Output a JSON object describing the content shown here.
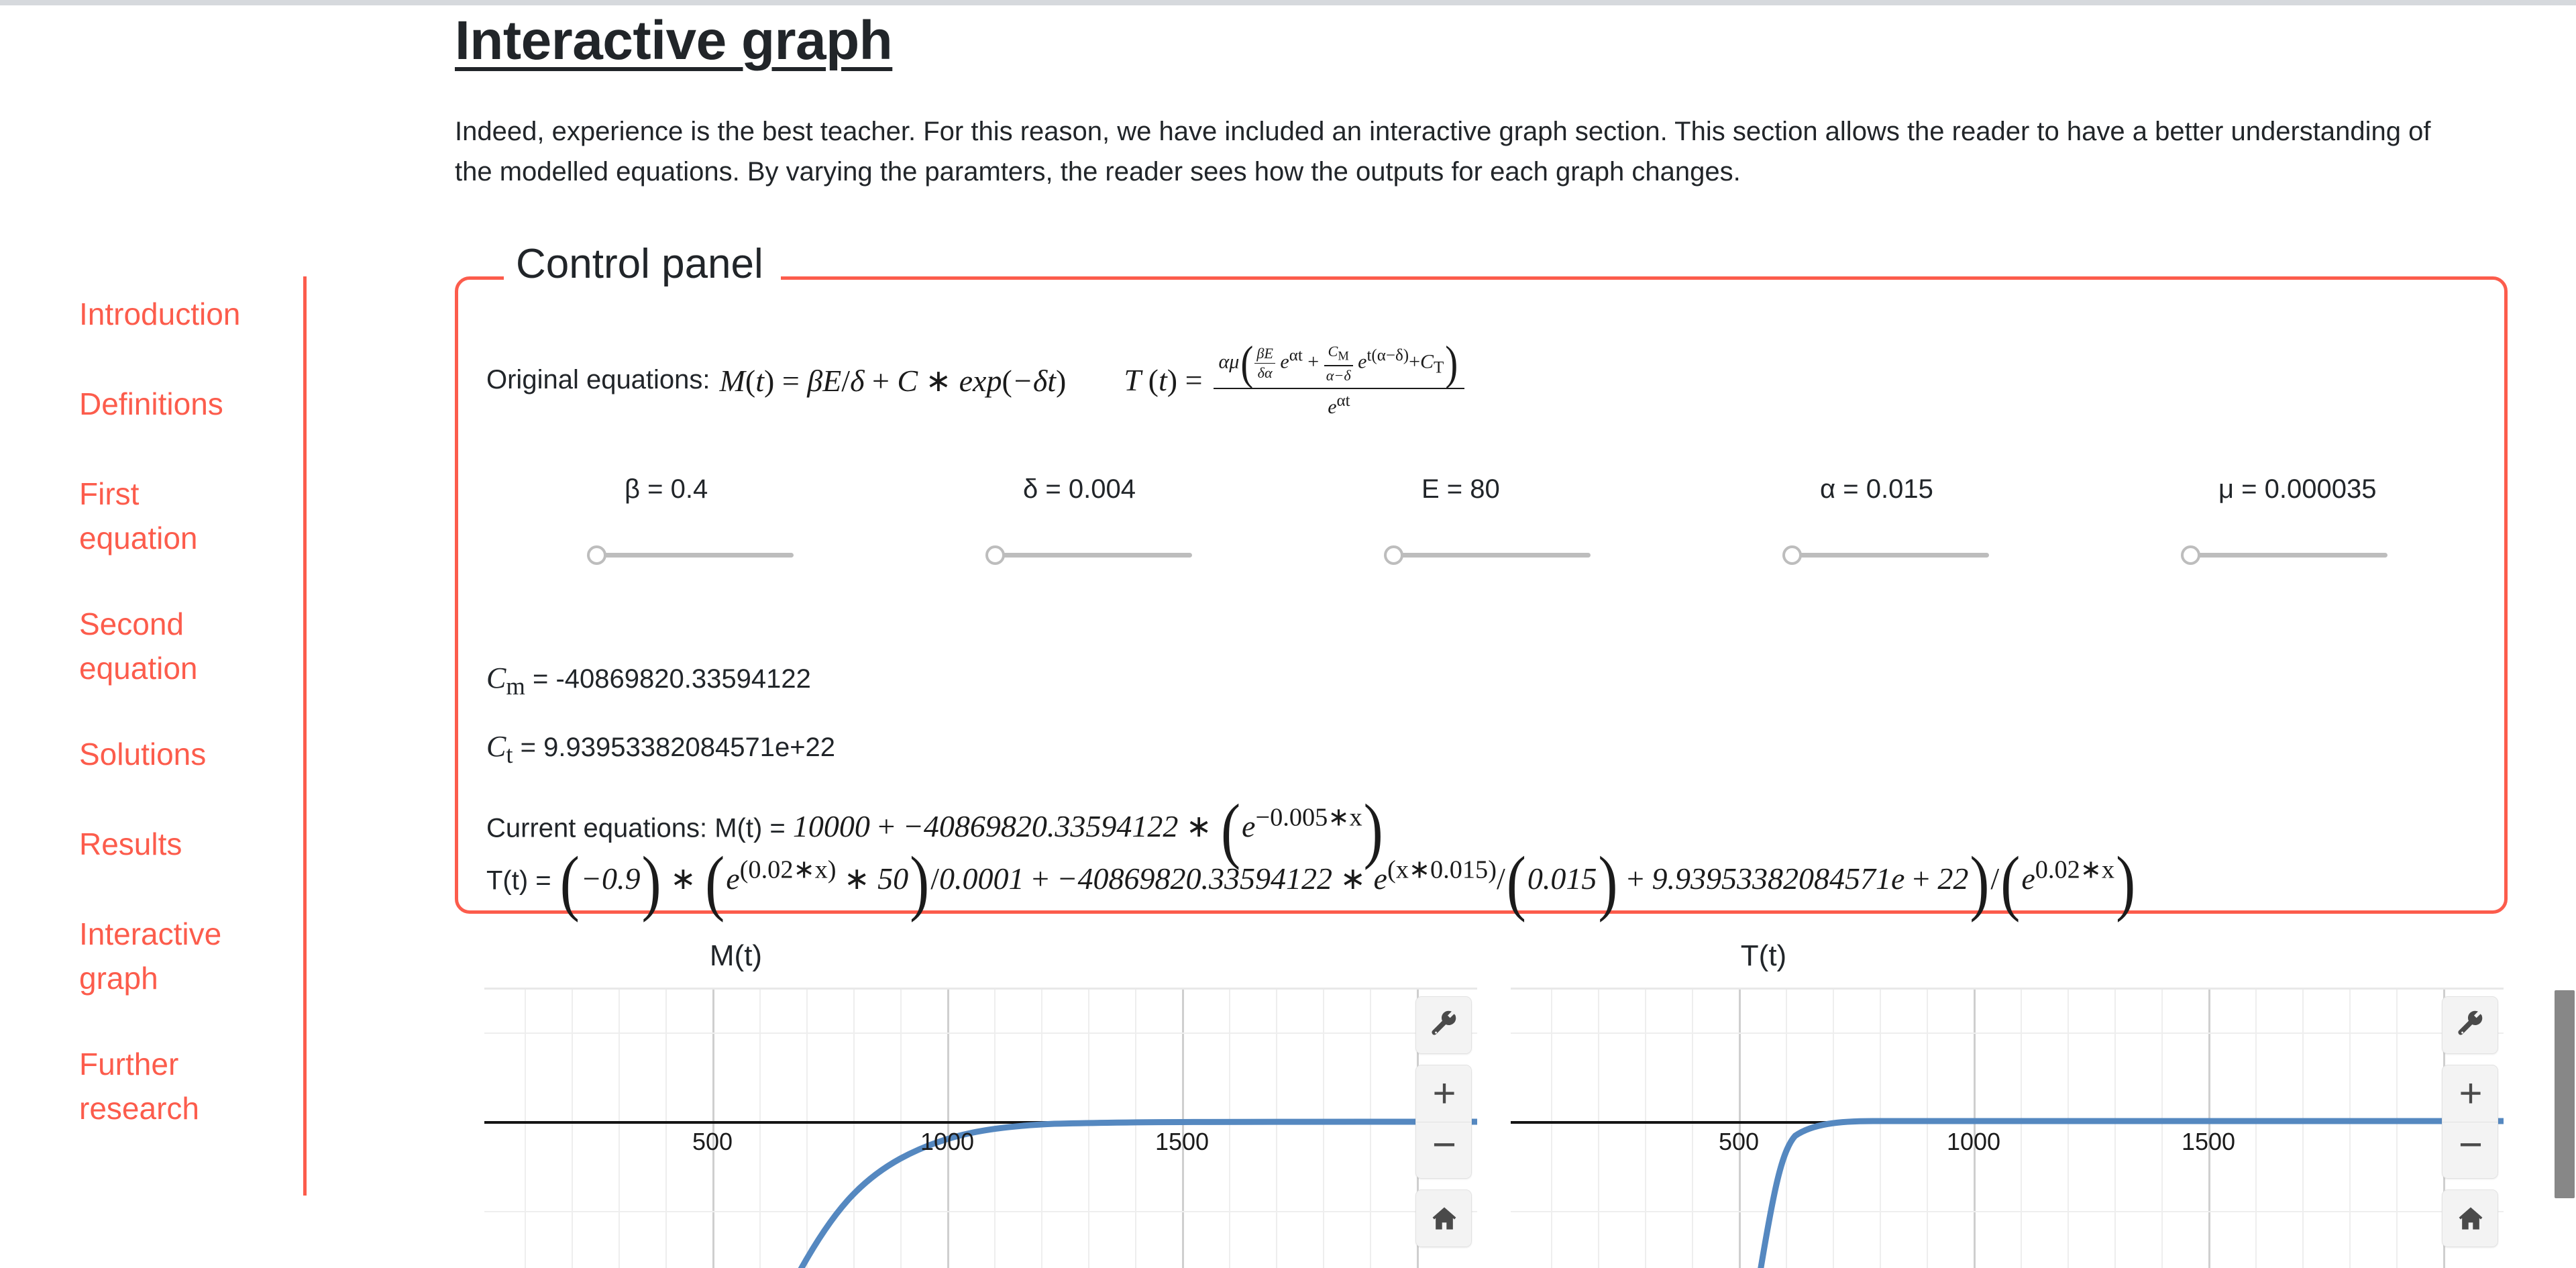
{
  "page": {
    "title": "Interactive graph",
    "intro": "Indeed, experience is the best teacher. For this reason, we have included an interactive graph section. This section allows the reader to have a better understanding of the modelled equations. By varying the paramters, the reader sees how the outputs for each graph changes."
  },
  "sidebar": {
    "items": [
      {
        "label": "Introduction"
      },
      {
        "label": "Definitions"
      },
      {
        "label": "First equation"
      },
      {
        "label": "Second equation"
      },
      {
        "label": "Solutions"
      },
      {
        "label": "Results"
      },
      {
        "label": "Interactive graph"
      },
      {
        "label": "Further research"
      }
    ]
  },
  "panel": {
    "legend": "Control panel",
    "original_equations_label": "Original equations:",
    "original_equation_m": "M(t) = βE/δ + C * exp(−δt)",
    "original_equation_t": "T(t) = αμ( (βE/δα) e^{αt} + (C_M/(α−δ)) e^{t(α−δ)} + C_T ) / e^{αt}",
    "sliders": [
      {
        "name": "beta",
        "label": "β = 0.4",
        "value": "0.4",
        "position_pct": 0
      },
      {
        "name": "delta",
        "label": "δ = 0.004",
        "value": "0.004",
        "position_pct": 0
      },
      {
        "name": "E",
        "label": "E = 80",
        "value": "80",
        "position_pct": 0
      },
      {
        "name": "alpha",
        "label": "α = 0.015",
        "value": "0.015",
        "position_pct": 0
      },
      {
        "name": "mu",
        "label": "μ = 0.000035",
        "value": "0.000035",
        "position_pct": 0
      }
    ],
    "constants": {
      "cm_symbol": "C",
      "cm_subscript": "m",
      "cm_equals": "= -40869820.33594122",
      "cm_value": "-40869820.33594122",
      "ct_symbol": "C",
      "ct_subscript": "t",
      "ct_equals": "= 9.93953382084571e+22",
      "ct_value": "9.93953382084571e+22"
    },
    "current_equations_label": "Current equations:",
    "current_equation_m_prefix": "M(t) =",
    "current_equation_m": "10000 + −40869820.33594122 * (e^{−0.005*x})",
    "current_equation_t_prefix": "T(t) =",
    "current_equation_t": "(−0.9) * (e^{(0.02*x)} * 50)/0.0001 + −40869820.33594122 * e^{(x*0.015)}/(0.015) + 9.93953382084571e + 22)/(e^{0.02*x})"
  },
  "graphs": [
    {
      "title": "M(t)",
      "xticks": [
        "500",
        "1000",
        "1500"
      ],
      "tools": {
        "wrench": "wrench-icon",
        "zoom_in": "+",
        "zoom_out": "−",
        "home": "home-icon"
      }
    },
    {
      "title": "T(t)",
      "xticks": [
        "500",
        "1000",
        "1500"
      ],
      "tools": {
        "wrench": "wrench-icon",
        "zoom_in": "+",
        "zoom_out": "−",
        "home": "home-icon"
      }
    }
  ],
  "chart_data": [
    {
      "type": "line",
      "title": "M(t)",
      "xlabel": "",
      "ylabel": "",
      "xticks": [
        500,
        1000,
        1500
      ],
      "xlim": [
        -120,
        1810
      ],
      "legend": "none",
      "grid": true,
      "series": [
        {
          "name": "M(t)",
          "color": "#5588c0",
          "description": "Rising exponential saturating toward the horizontal asymptote at y = 0 (the black axis line); crosses below the visible frame near x = 700 and approaches the axis from below after x ≈ 1400.",
          "x": [
            700,
            760,
            820,
            880,
            940,
            1000,
            1060,
            1120,
            1180,
            1240,
            1300,
            1360,
            1420,
            1500,
            1600,
            1700,
            1810
          ],
          "y": [
            -420,
            -330,
            -258,
            -200,
            -154,
            -118,
            -90,
            -68,
            -51,
            -38,
            -28,
            -20,
            -14,
            -8,
            -4,
            -2,
            -1
          ]
        }
      ]
    },
    {
      "type": "line",
      "title": "T(t)",
      "xlabel": "",
      "ylabel": "",
      "xticks": [
        500,
        1000,
        1500
      ],
      "xlim": [
        -120,
        1810
      ],
      "legend": "none",
      "grid": true,
      "series": [
        {
          "name": "T(t)",
          "color": "#5588c0",
          "description": "Steeply rising exponential that saturates onto the horizontal axis near x = 750 and stays flat along y = 0 for the rest of the range.",
          "x": [
            400,
            440,
            480,
            520,
            560,
            600,
            640,
            680,
            720,
            760,
            800,
            900,
            1000,
            1200,
            1400,
            1600,
            1810
          ],
          "y": [
            -430,
            -330,
            -246,
            -178,
            -124,
            -82,
            -52,
            -30,
            -16,
            -8,
            -4,
            -1,
            0,
            0,
            0,
            0,
            0
          ]
        }
      ]
    }
  ],
  "scrollbar": {
    "present": true
  }
}
